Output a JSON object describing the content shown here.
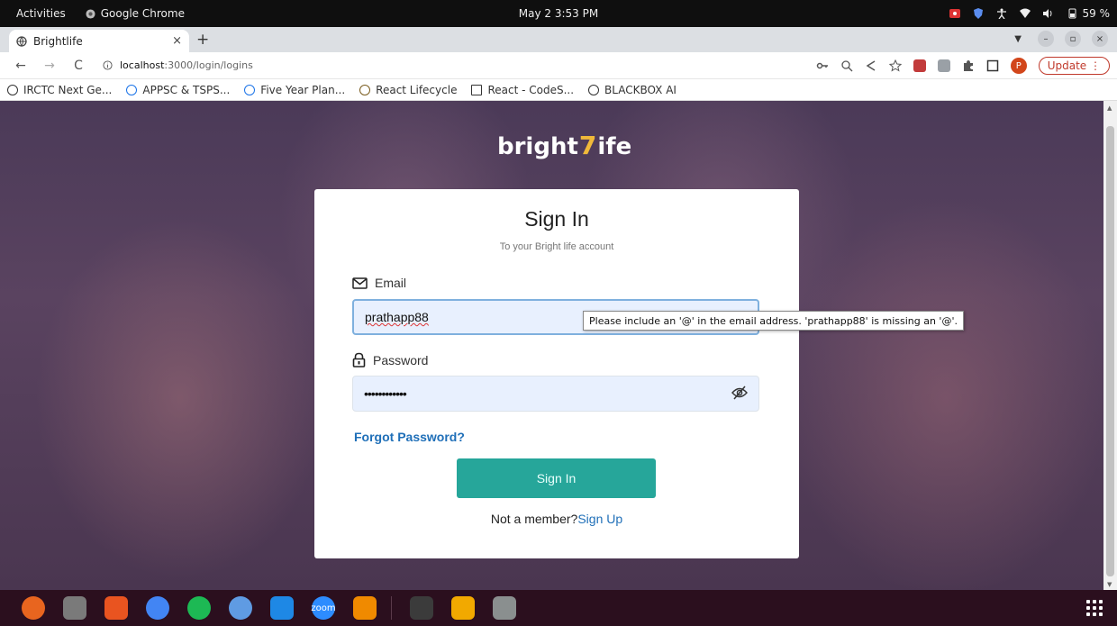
{
  "topbar": {
    "activities": "Activities",
    "app_name": "Google Chrome",
    "clock": "May 2  3:53 PM",
    "battery": "59 %"
  },
  "tab": {
    "title": "Brightlife",
    "close": "×",
    "new_tab": "+"
  },
  "window_controls": {
    "minimize": "–",
    "restore": "▫",
    "close": "×"
  },
  "toolbar": {
    "url_host": "localhost",
    "url_path": ":3000/login/logins",
    "profile_initial": "P",
    "update_label": "Update"
  },
  "bookmarks": [
    {
      "label": "IRCTC Next Ge...",
      "icon": "globe-icon",
      "color": "#333333"
    },
    {
      "label": "APPSC & TSPS...",
      "icon": "funnel-icon",
      "color": "#1a73e8"
    },
    {
      "label": "Five Year Plan...",
      "icon": "upload-circle-icon",
      "color": "#1a73e8"
    },
    {
      "label": "React Lifecycle",
      "icon": "w-icon",
      "color": "#7a5c1e"
    },
    {
      "label": "React - CodeS...",
      "icon": "page-icon",
      "color": "#333333"
    },
    {
      "label": "BLACKBOX AI",
      "icon": "globe-icon",
      "color": "#333333"
    }
  ],
  "logo": {
    "left": "bright",
    "mark": "7",
    "right": "ife"
  },
  "signin": {
    "title": "Sign In",
    "subtitle": "To your Bright life account",
    "email_label": "Email",
    "email_value": "prathapp88",
    "password_label": "Password",
    "password_value": "••••••••••••",
    "forgot": "Forgot Password?",
    "button": "Sign In",
    "member_text": "Not a member?",
    "signup_link": "Sign Up"
  },
  "tooltip": "Please include an '@' in the email address. 'prathapp88' is missing an '@'.",
  "colors": {
    "accent": "#26a69a",
    "link": "#1f6fb8",
    "update": "#c0392b"
  },
  "dock": [
    {
      "name": "firefox-icon",
      "color": "#e8651f"
    },
    {
      "name": "files-icon",
      "color": "#7a7a7a"
    },
    {
      "name": "software-center-icon",
      "color": "#e95420"
    },
    {
      "name": "chrome-icon",
      "color": "#4285f4"
    },
    {
      "name": "spotify-icon",
      "color": "#1db954"
    },
    {
      "name": "chromium-icon",
      "color": "#5f9be3"
    },
    {
      "name": "vscode-icon",
      "color": "#1e88e5"
    },
    {
      "name": "zoom-icon",
      "color": "#2d8cff",
      "label": "zoom"
    },
    {
      "name": "vlc-icon",
      "color": "#f08a00"
    },
    {
      "name": "terminal-icon",
      "color": "#3b3b3b"
    },
    {
      "name": "impress-icon",
      "color": "#f2a900"
    },
    {
      "name": "trash-icon",
      "color": "#8a8f8f"
    }
  ]
}
